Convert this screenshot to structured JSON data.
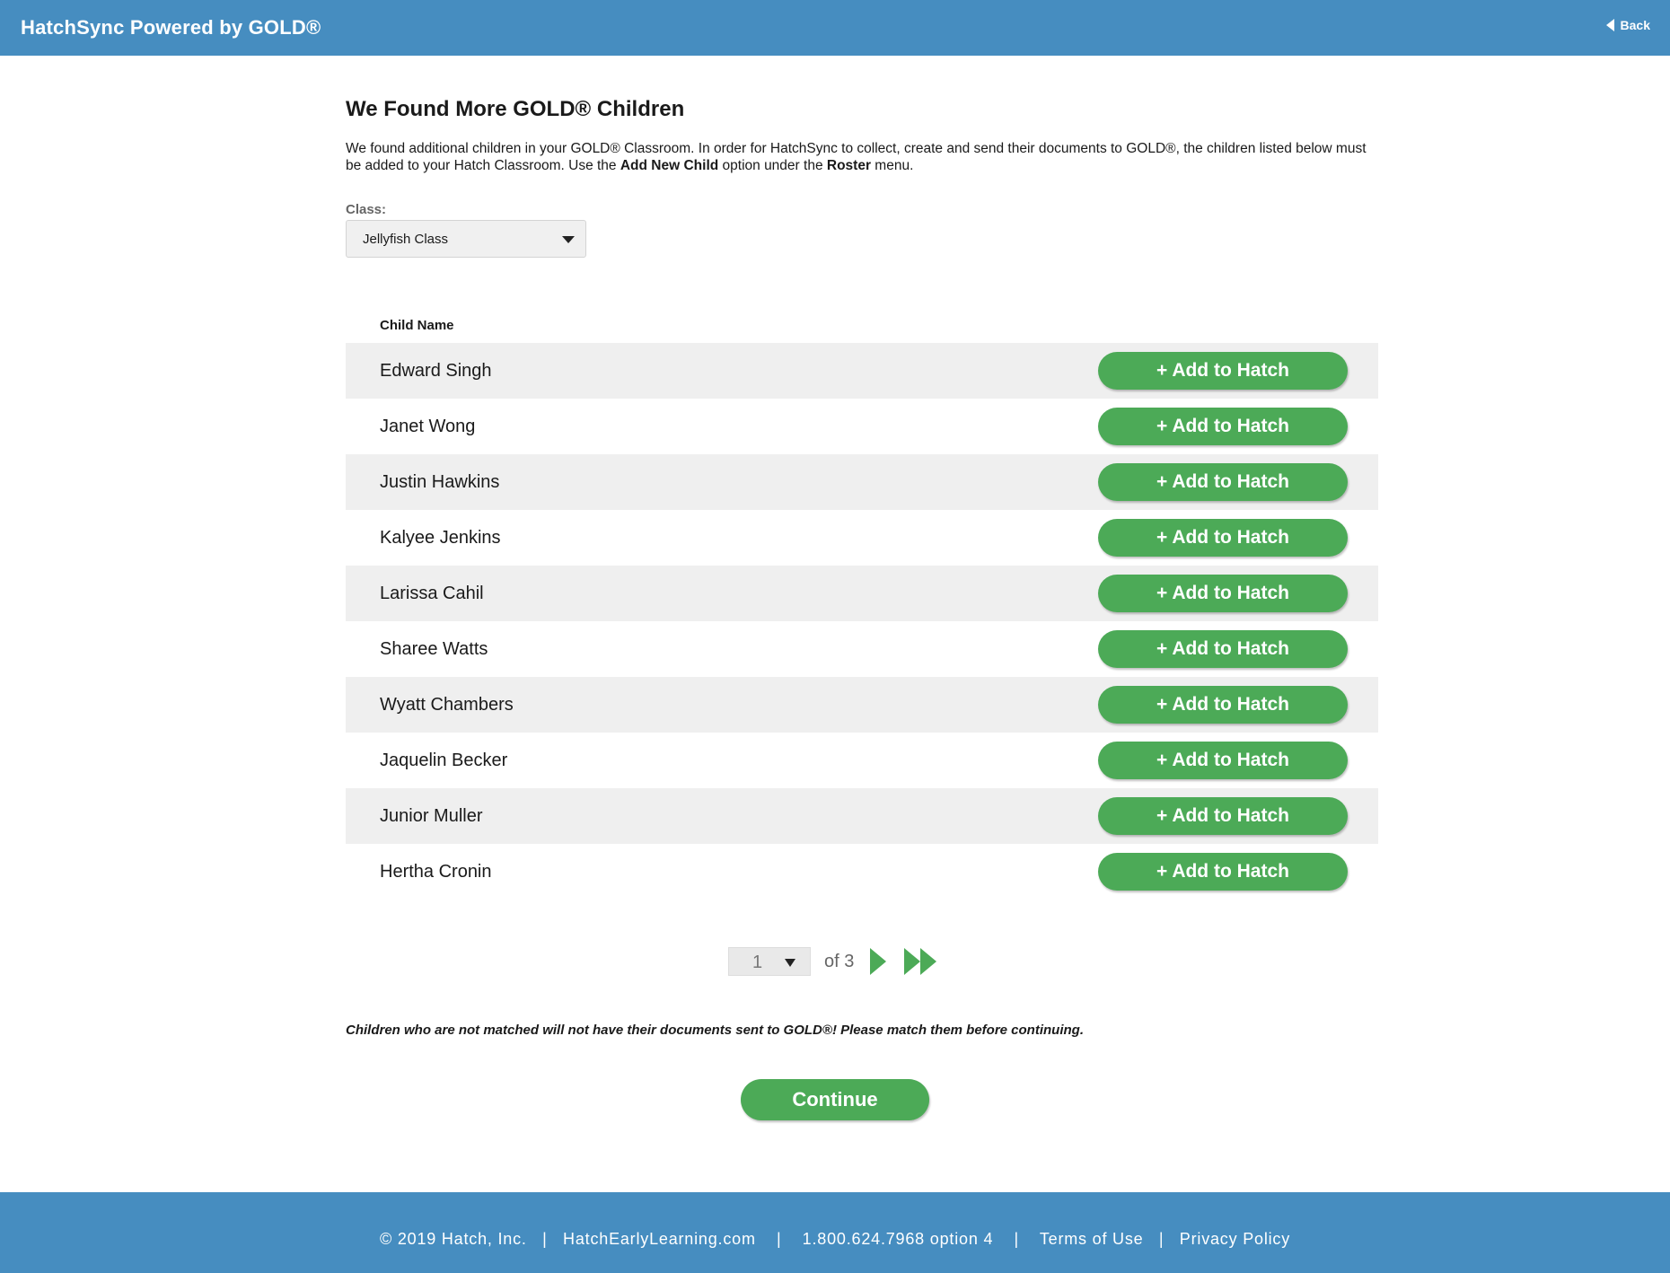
{
  "header": {
    "app_title": "HatchSync Powered by GOLD®",
    "back_label": "Back"
  },
  "main": {
    "title": "We Found More GOLD® Children",
    "intro_part1": "We found additional children in your GOLD® Classroom. In order for HatchSync to collect, create and send their documents to GOLD®, the children listed below must be added to your Hatch Classroom. Use the ",
    "intro_bold1": "Add New Child",
    "intro_part2": " option under the ",
    "intro_bold2": "Roster",
    "intro_part3": " menu.",
    "class_label": "Class:",
    "class_value": "Jellyfish Class",
    "column_header": "Child Name",
    "add_button_label": "+ Add to Hatch",
    "children": [
      {
        "name": "Edward Singh"
      },
      {
        "name": "Janet Wong"
      },
      {
        "name": "Justin Hawkins"
      },
      {
        "name": "Kalyee Jenkins"
      },
      {
        "name": "Larissa Cahil"
      },
      {
        "name": "Sharee Watts"
      },
      {
        "name": "Wyatt Chambers"
      },
      {
        "name": "Jaquelin Becker"
      },
      {
        "name": "Junior Muller"
      },
      {
        "name": "Hertha Cronin"
      }
    ],
    "pagination": {
      "current_page": "1",
      "of_text": "of 3"
    },
    "warning": "Children who are not matched will not have their documents sent to GOLD®! Please match them before continuing.",
    "continue_label": "Continue"
  },
  "footer": {
    "copyright": "© 2019 Hatch, Inc.",
    "site": "HatchEarlyLearning.com",
    "phone": "1.800.624.7968 option 4",
    "terms": "Terms of Use",
    "privacy": "Privacy Policy",
    "separator": "|"
  },
  "colors": {
    "header_blue": "#468dc0",
    "button_green": "#4caa57",
    "row_shade": "#efefef"
  }
}
